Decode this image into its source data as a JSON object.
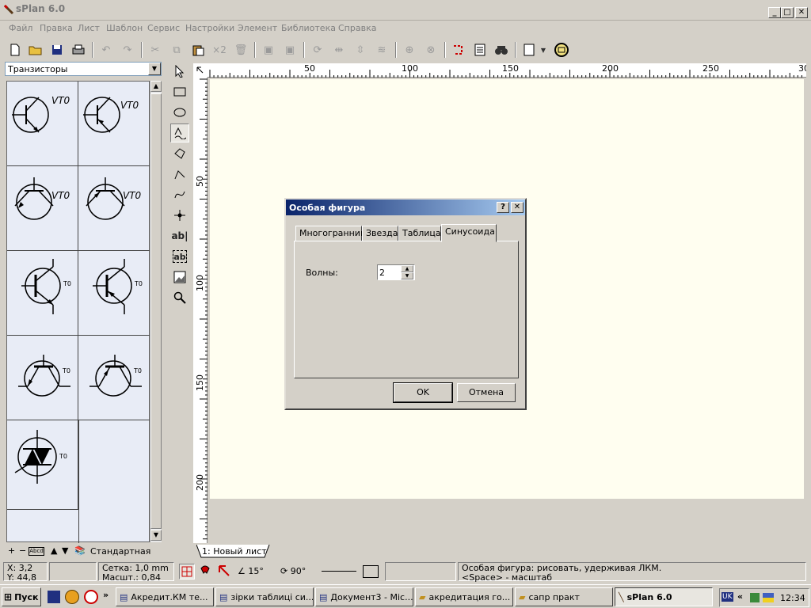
{
  "window": {
    "title": "sPlan 6.0",
    "min": "_",
    "max": "□",
    "close": "✕"
  },
  "menu": [
    "Файл",
    "Правка",
    "Лист",
    "Шаблон",
    "Сервис",
    "Настройки",
    "Элемент",
    "Библиотека",
    "Справка"
  ],
  "toolbar": {
    "multiply_label": "×2"
  },
  "library": {
    "selected": "Транзисторы",
    "labels": [
      "VT0",
      "VT0",
      "VT0",
      "VT0",
      "T0",
      "T0",
      "T0",
      "T0",
      "T0"
    ],
    "footer": "Стандартная"
  },
  "ruler": {
    "top": [
      "50",
      "100",
      "150",
      "200",
      "250",
      "30"
    ],
    "left": [
      "50",
      "100",
      "150",
      "200"
    ]
  },
  "tools": {
    "text1": "ab|",
    "text2": "ab"
  },
  "sheet_tab": "1: Новый лист",
  "dialog": {
    "title": "Особая фигура",
    "help": "?",
    "close": "✕",
    "tabs": [
      "Многогранник",
      "Звезда",
      "Таблица",
      "Синусоида"
    ],
    "field_label": "Волны:",
    "field_value": "2",
    "ok": "OK",
    "cancel": "Отмена"
  },
  "status": {
    "x": "X: 3,2",
    "y": "Y: 44,8",
    "grid": "Сетка:  1,0 mm",
    "scale": "Масшт.: 0,84",
    "angle1": "15°",
    "angle2": "90°",
    "hint1": "Особая фигура: рисовать, удерживая ЛКМ.",
    "hint2": "<Space> - масштаб"
  },
  "taskbar": {
    "start": "Пуск",
    "tasks": [
      "Акредит.КМ те...",
      "зірки таблиці си...",
      "Документ3 - Mic...",
      "акредитация го...",
      "сапр практ",
      "sPlan 6.0"
    ],
    "lang": "UK",
    "clock": "12:34"
  }
}
